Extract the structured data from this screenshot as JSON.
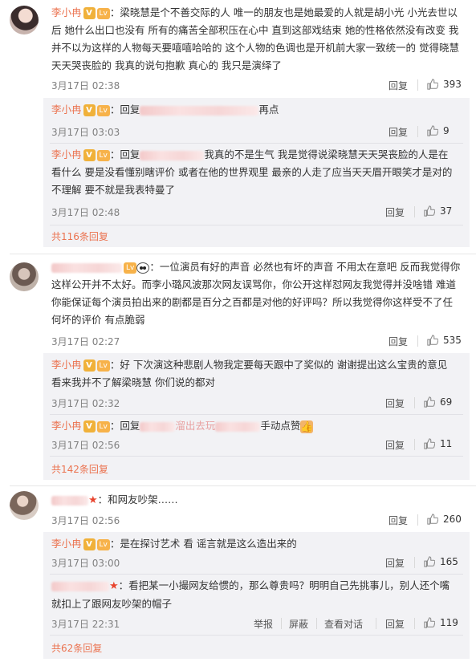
{
  "actions": {
    "reply": "回复",
    "report": "举报",
    "block": "屏蔽",
    "delete": "查看对话"
  },
  "threads": [
    {
      "user": "李小冉",
      "text_parts": [
        "梁晓慧是个不善交际的人 唯一的朋友也是她最爱的人就是胡小光 小光去世以后 她什么出口也没有 所有的痛苦全部积压在心中 直到这部戏结束 她的性格依然没有改变 我并不以为这样的人物每天要嘻嘻哈哈的 这个人物的色调也是开机前大家一致统一的 觉得晓慧天天哭丧脸的 我真的说句抱歉 真心的 我只是演绎了"
      ],
      "time": "3月17日 02:38",
      "likes": "393",
      "replies": [
        {
          "user": "李小冉",
          "prefix": "：回复",
          "suffix": "再点",
          "time": "3月17日 03:03",
          "likes": "9"
        },
        {
          "user": "李小冉",
          "prefix": "：回复",
          "suffix": "我真的不是生气 我是觉得说梁晓慧天天哭丧脸的人是在看什么 要是没看懂别瞎评价 或者在他的世界观里 最亲的人走了应当天天眉开眼笑才是对的 不理解 要不就是我表特曼了",
          "time": "3月17日 02:48",
          "likes": "37"
        }
      ],
      "more": "共116条回复"
    },
    {
      "text_parts": [
        "一位演员有好的声音 必然也有坏的声音 不用太在意吧  反而我觉得你这样公开并不太好。而李小璐风波那次网友误骂你，你公开这样怼网友我觉得并没啥错  难道你能保证每个演员拍出来的剧都是百分之百都是对他的好评吗？所以我觉得你这样受不了任何坏的评价 有点脆弱"
      ],
      "time": "3月17日 02:27",
      "likes": "535",
      "replies": [
        {
          "user": "李小冉",
          "prefix": "：好 下次演这种悲剧人物我定要每天跟中了奖似的 谢谢提出这么宝贵的意见 看来我并不了解梁晓慧 你们说的都对",
          "suffix": "",
          "time": "3月17日 02:32",
          "likes": "69"
        },
        {
          "user": "李小冉",
          "prefix": "：回复",
          "mid": "溜出去玩",
          "suffix": "手动点赞",
          "time": "3月17日 02:56",
          "likes": "11"
        }
      ],
      "more": "共142条回复"
    },
    {
      "text_parts": [
        "：和网友吵架……"
      ],
      "time": "3月17日 02:56",
      "likes": "260",
      "replies": [
        {
          "user": "李小冉",
          "prefix": "：是在探讨艺术 看 谣言就是这么造出来的",
          "suffix": "",
          "time": "3月17日 03:00",
          "likes": "165"
        },
        {
          "user": "",
          "prefix": "：看把某一小撮网友给惯的，那么尊贵吗？明明自己先挑事儿，别人还个嘴就扣上了跟网友吵架的帽子",
          "suffix": "",
          "time": "3月17日 22:31",
          "likes": "119"
        }
      ],
      "more": "共62条回复"
    }
  ],
  "badges": {
    "verified": "V",
    "level": "Lv"
  },
  "colors": {
    "accent": "#eb7350",
    "reply_bg": "#f2f2f5"
  }
}
